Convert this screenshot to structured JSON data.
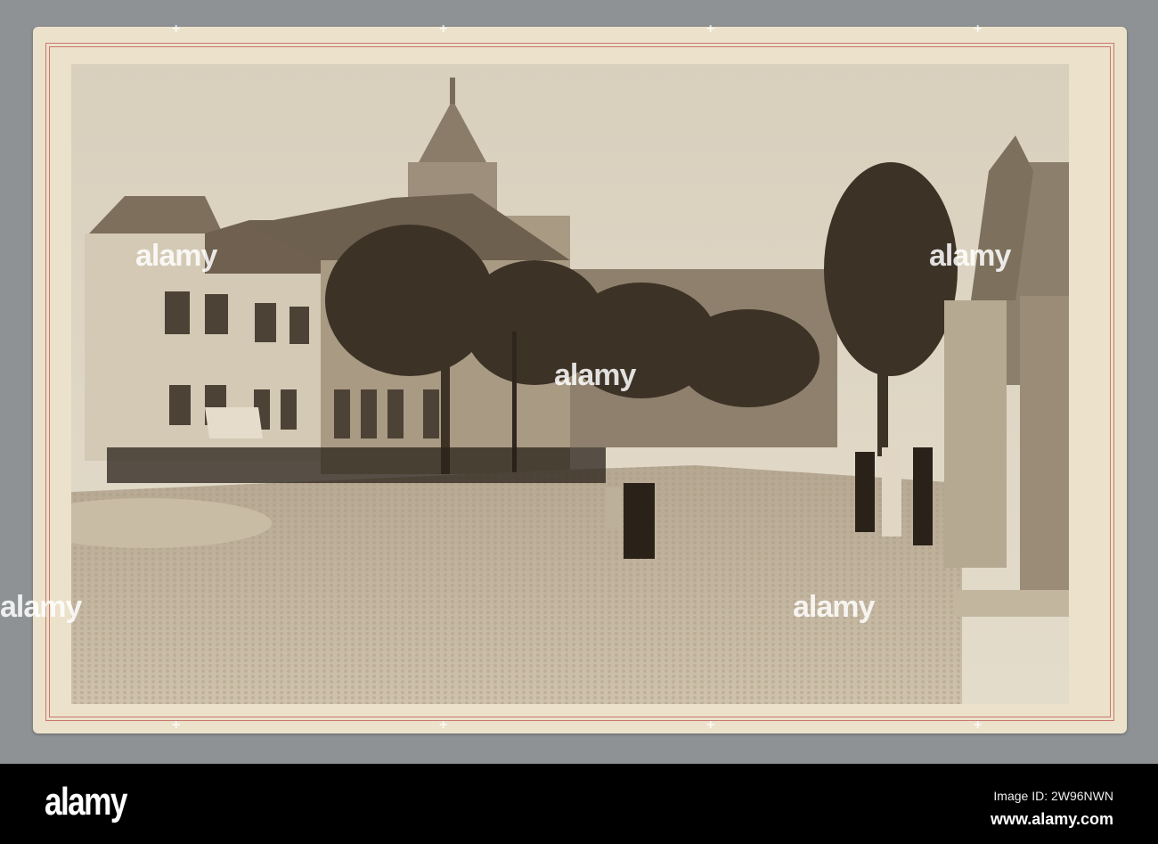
{
  "watermark": {
    "text": "alamy"
  },
  "footer": {
    "logo": "alamy",
    "image_id": "Image ID: 2W96NWN",
    "url": "www.alamy.com"
  },
  "colors": {
    "background": "#8e9295",
    "card": "#ece2cb",
    "border_red": "#c9776e",
    "sepia": "#b8a88e"
  }
}
